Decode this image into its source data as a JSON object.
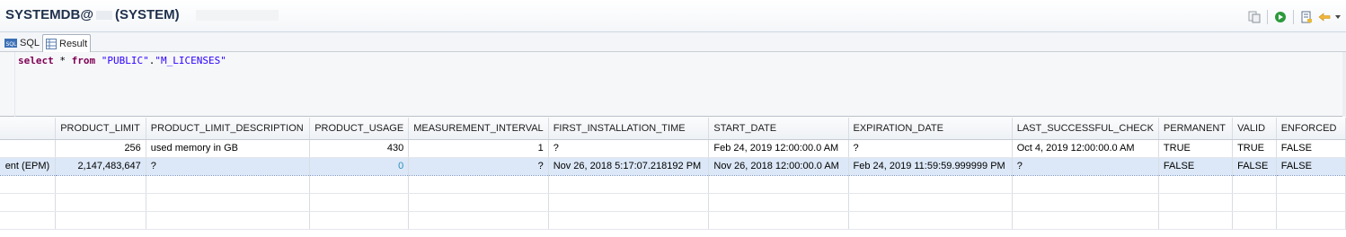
{
  "header": {
    "title_prefix": "SYSTEMDB@",
    "title_suffix": "(SYSTEM)"
  },
  "toolbar": {
    "icons": [
      "copy-icon",
      "execute-icon",
      "settings-icon",
      "back-arrow-icon"
    ]
  },
  "tabs": [
    {
      "label": "SQL",
      "icon": "sql-icon"
    },
    {
      "label": "Result",
      "icon": "grid-icon"
    }
  ],
  "editor": {
    "kw_select": "select",
    "star": " * ",
    "kw_from": "from",
    "space": " ",
    "schema": "\"PUBLIC\"",
    "dot": ".",
    "table": "\"M_LICENSES\""
  },
  "grid": {
    "columns": [
      "",
      "PRODUCT_LIMIT",
      "PRODUCT_LIMIT_DESCRIPTION",
      "PRODUCT_USAGE",
      "MEASUREMENT_INTERVAL",
      "FIRST_INSTALLATION_TIME",
      "START_DATE",
      "EXPIRATION_DATE",
      "LAST_SUCCESSFUL_CHECK",
      "PERMANENT",
      "VALID",
      "ENFORCED"
    ],
    "rows": [
      [
        "",
        "256",
        "used memory in GB",
        "430",
        "1",
        "?",
        "Feb 24, 2019 12:00:00.0 AM",
        "?",
        "Oct 4, 2019 12:00:00.0 AM",
        "TRUE",
        "TRUE",
        "FALSE"
      ],
      [
        "ent (EPM)",
        "2,147,483,647",
        "?",
        "0",
        "?",
        "Nov 26, 2018 5:17:07.218192 PM",
        "Nov 26, 2018 12:00:00.0 AM",
        "Feb 24, 2019 11:59:59.999999 PM",
        "?",
        "FALSE",
        "FALSE",
        "FALSE"
      ]
    ],
    "selected_row": 1
  },
  "colors": {
    "title": "#20314d",
    "keyword": "#7f0055",
    "string": "#2a00ff",
    "selection": "#dce8f7"
  }
}
